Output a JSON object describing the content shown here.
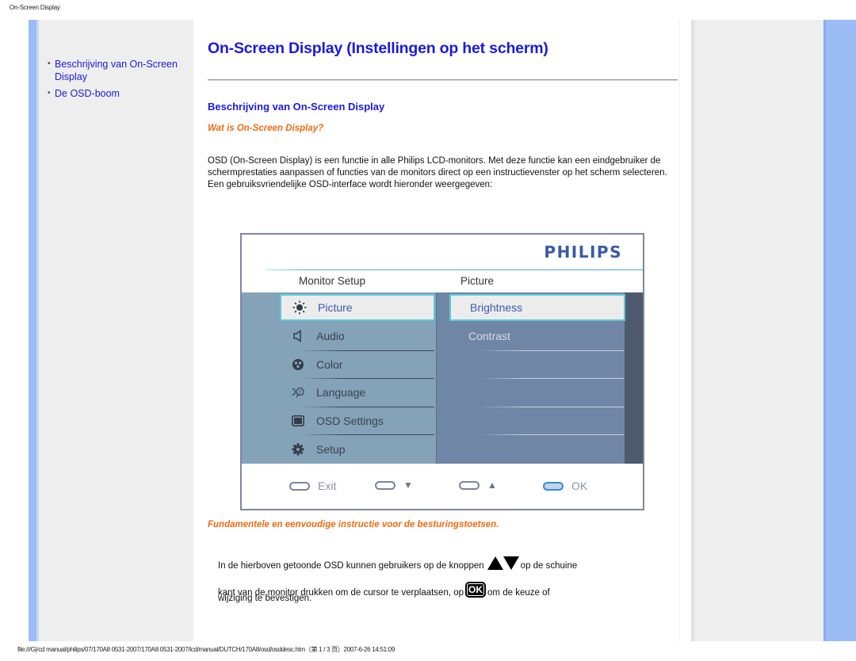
{
  "page": {
    "header_title": "On-Screen Display",
    "footer_path": "file:///G|/cd manual/philips/07/170A8 0531-2007/170A8 0531-2007/lcd/manual/DUTCH/170A8/osd/osddesc.htm（第 1 / 3 页）2007-6-26 14:51:09"
  },
  "sidebar": {
    "items": [
      {
        "label": "Beschrijving van On-Screen Display"
      },
      {
        "label": "De OSD-boom"
      }
    ]
  },
  "main": {
    "title": "On-Screen Display (Instellingen op het scherm)",
    "section_heading": "Beschrijving van On-Screen Display",
    "subheading": "Wat is On-Screen Display?",
    "intro": "OSD (On-Screen Display) is een functie in alle Philips LCD-monitors. Met deze functie kan een eindgebruiker de schermprestaties aanpassen of functies van de monitors direct op een instructievenster op het scherm selecteren. Een gebruiksvriendelijke OSD-interface wordt hieronder weergegeven:",
    "instructions_heading": "Fundamentele en eenvoudige instructie voor de besturingstoetsen.",
    "instructions": {
      "part1": "In de hierboven getoonde OSD kunnen gebruikers op de knoppen",
      "part2": "op de schuine",
      "part3": "kant van de monitor drukken om de cursor te verplaatsen, op",
      "part4": "om de keuze of",
      "part5": "wijziging te bevestigen.",
      "ok_key_label": "OK"
    }
  },
  "osd": {
    "brand": "PHILIPS",
    "header_left": "Monitor Setup",
    "header_right": "Picture",
    "menu": [
      {
        "label": "Picture",
        "icon": "brightness-icon",
        "selected": true
      },
      {
        "label": "Audio",
        "icon": "speaker-icon",
        "selected": false
      },
      {
        "label": "Color",
        "icon": "color-palette-icon",
        "selected": false
      },
      {
        "label": "Language",
        "icon": "language-icon",
        "selected": false
      },
      {
        "label": "OSD Settings",
        "icon": "monitor-icon",
        "selected": false
      },
      {
        "label": "Setup",
        "icon": "gear-icon",
        "selected": false
      }
    ],
    "submenu": [
      {
        "label": "Brightness",
        "selected": true
      },
      {
        "label": "Contrast",
        "selected": false
      }
    ],
    "buttons": [
      {
        "label": "Exit"
      },
      {
        "label": "▼"
      },
      {
        "label": "▲"
      },
      {
        "label": "OK"
      }
    ]
  }
}
